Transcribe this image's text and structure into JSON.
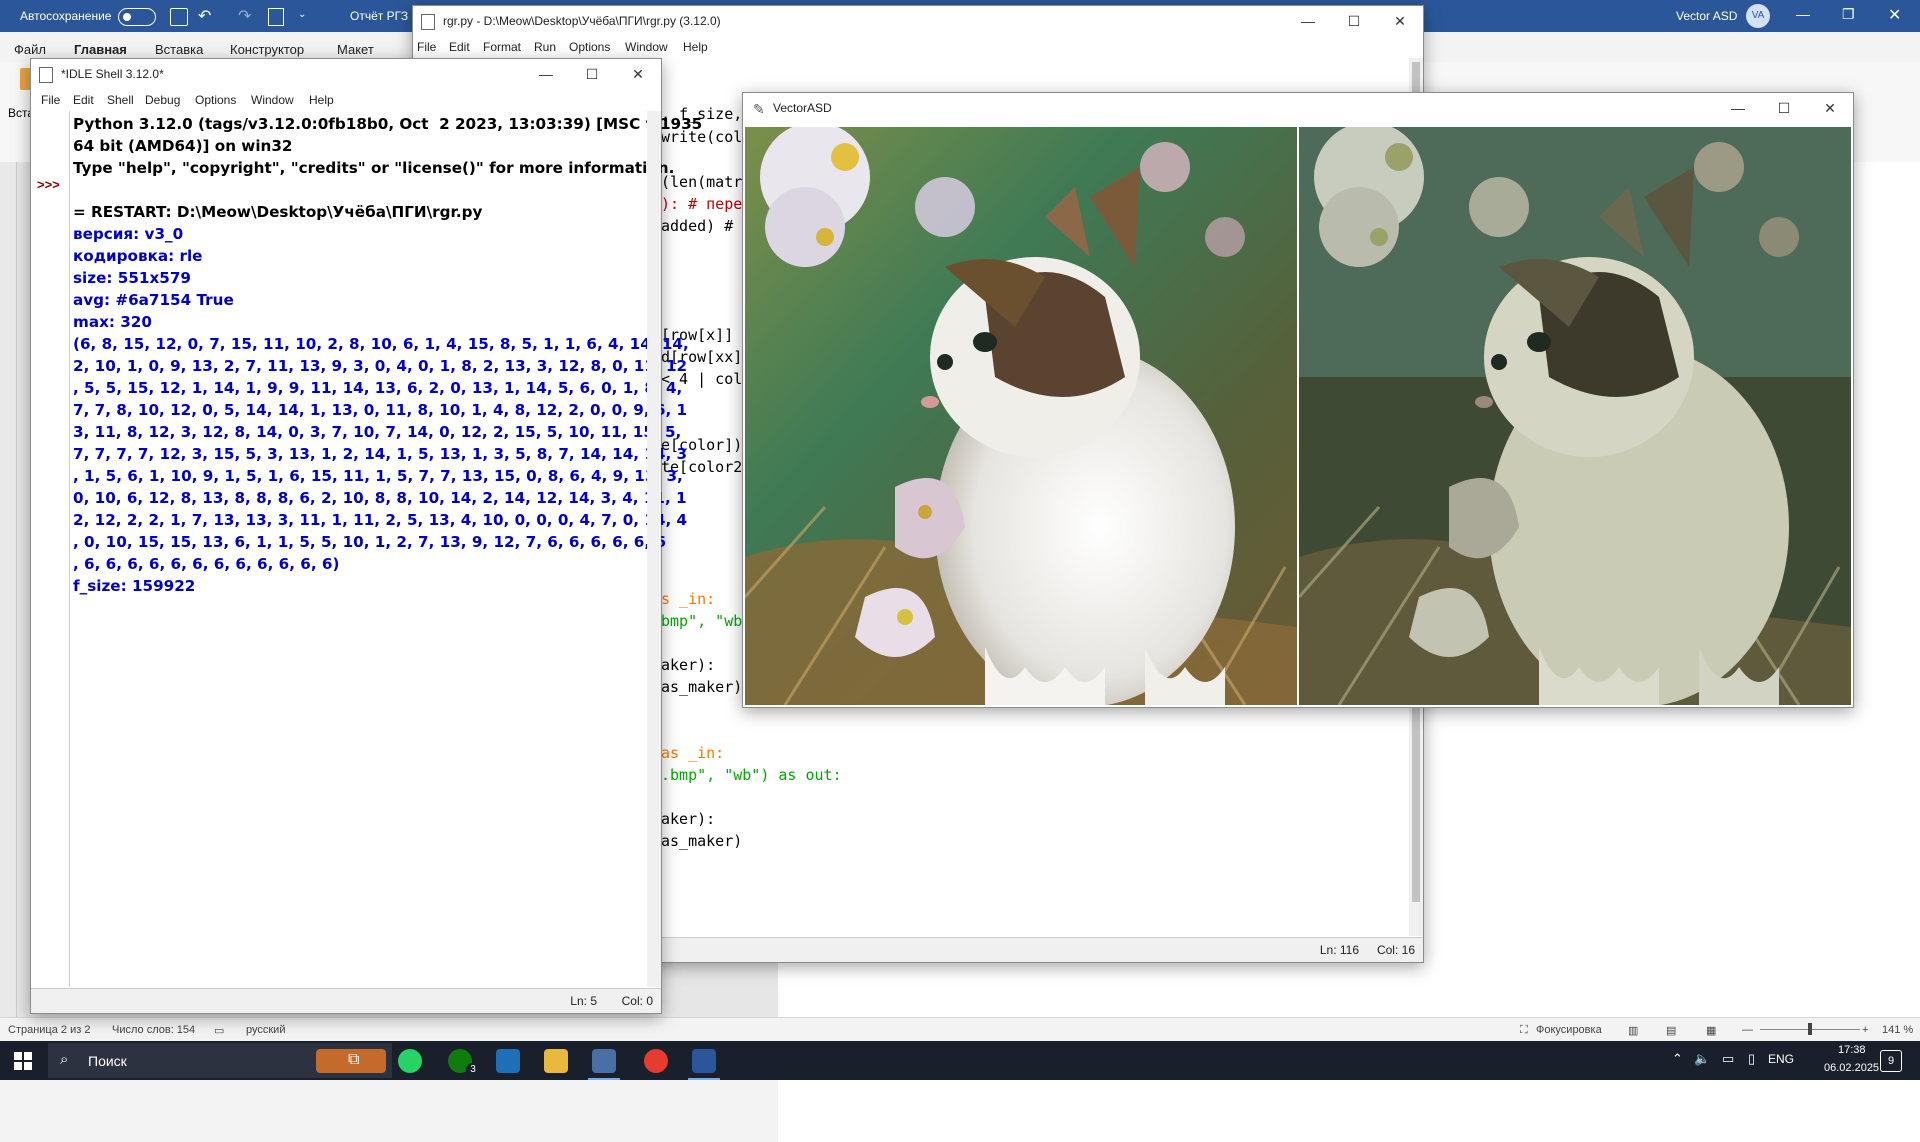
{
  "word": {
    "autosave_label": "Автосохранение",
    "doc_title": "Отчёт РГЗ",
    "user_name": "Vector ASD",
    "user_initials": "VA",
    "tabs": [
      "Файл",
      "Главная",
      "Вставка",
      "Конструктор",
      "Макет"
    ],
    "paste_label": "Вста",
    "status": {
      "page": "Страница 2 из 2",
      "words": "Число слов: 154",
      "language": "русский",
      "focus": "Фокусировка",
      "zoom": "141 %"
    }
  },
  "editor": {
    "title": "rgr.py - D:\\Meow\\Desktop\\Учёба\\ПГИ\\rgr.py (3.12.0)",
    "menu": [
      "File",
      "Edit",
      "Format",
      "Run",
      "Options",
      "Window",
      "Help"
    ],
    "code_fragments": [
      ", f_size, r",
      "write(color",
      "(len(matrix",
      "): # перевё",
      "added) # re",
      "[row[x]]",
      "d[row[xx]]",
      "< 4 | color",
      "e[color])",
      "te[color2])",
      "s _in:",
      "bmp\", \"wb\")",
      "aker):",
      "as_maker)",
      "as _in:",
      ".bmp\", \"wb\") as out:",
      "aker):",
      "as_maker)"
    ],
    "status": {
      "ln": "Ln: 116",
      "col": "Col: 16"
    }
  },
  "shell": {
    "title": "*IDLE Shell 3.12.0*",
    "menu": [
      "File",
      "Edit",
      "Shell",
      "Debug",
      "Options",
      "Window",
      "Help"
    ],
    "prompt": ">>>",
    "lines": [
      {
        "text": "Python 3.12.0 (tags/v3.12.0:0fb18b0, Oct  2 2023, 13:03:39) [MSC v.1935",
        "color": "blk"
      },
      {
        "text": "64 bit (AMD64)] on win32",
        "color": "blk"
      },
      {
        "text": "Type \"help\", \"copyright\", \"credits\" or \"license()\" for more information.",
        "color": "blk"
      },
      {
        "text": "",
        "color": "blk"
      },
      {
        "text": "= RESTART: D:\\Meow\\Desktop\\Учёба\\ПГИ\\rgr.py",
        "color": "blk"
      },
      {
        "text": "версия: v3_0",
        "color": "blue"
      },
      {
        "text": "кодировка: rle",
        "color": "blue"
      },
      {
        "text": "size: 551x579",
        "color": "blue"
      },
      {
        "text": "avg: #6a7154 True",
        "color": "blue"
      },
      {
        "text": "max: 320",
        "color": "blue"
      },
      {
        "text": "(6, 8, 15, 12, 0, 7, 15, 11, 10, 2, 8, 10, 6, 1, 4, 15, 8, 5, 1, 1, 6, 4, 14, 14,",
        "color": "blue"
      },
      {
        "text": "2, 10, 1, 0, 9, 13, 2, 7, 11, 13, 9, 3, 0, 4, 0, 1, 8, 2, 13, 3, 12, 8, 0, 11, 12",
        "color": "blue"
      },
      {
        "text": ", 5, 5, 15, 12, 1, 14, 1, 9, 9, 11, 14, 13, 6, 2, 0, 13, 1, 14, 5, 6, 0, 1, 8, 4,",
        "color": "blue"
      },
      {
        "text": "7, 7, 8, 10, 12, 0, 5, 14, 14, 1, 13, 0, 11, 8, 10, 1, 4, 8, 12, 2, 0, 0, 9, 6, 1",
        "color": "blue"
      },
      {
        "text": "3, 11, 8, 12, 3, 12, 8, 14, 0, 3, 7, 10, 7, 14, 0, 12, 2, 15, 5, 10, 11, 15, 5,",
        "color": "blue"
      },
      {
        "text": "7, 7, 7, 7, 12, 3, 15, 5, 3, 13, 1, 2, 14, 1, 5, 13, 1, 3, 5, 8, 7, 14, 14, 14, 3",
        "color": "blue"
      },
      {
        "text": ", 1, 5, 6, 1, 10, 9, 1, 5, 1, 6, 15, 11, 1, 5, 7, 7, 13, 15, 0, 8, 6, 4, 9, 13, 3,",
        "color": "blue"
      },
      {
        "text": "0, 10, 6, 12, 8, 13, 8, 8, 8, 6, 2, 10, 8, 8, 10, 14, 2, 14, 12, 14, 3, 4, 11, 1",
        "color": "blue"
      },
      {
        "text": "2, 12, 2, 2, 1, 7, 13, 13, 3, 11, 1, 11, 2, 5, 13, 4, 10, 0, 0, 0, 4, 7, 0, 14, 4",
        "color": "blue"
      },
      {
        "text": ", 0, 10, 15, 15, 13, 6, 1, 1, 5, 5, 10, 1, 2, 7, 13, 9, 12, 7, 6, 6, 6, 6, 6, 6",
        "color": "blue"
      },
      {
        "text": ", 6, 6, 6, 6, 6, 6, 6, 6, 6, 6, 6, 6)",
        "color": "blue"
      },
      {
        "text": "f_size: 159922",
        "color": "blue"
      }
    ],
    "status": {
      "ln": "Ln: 5",
      "col": "Col: 0"
    }
  },
  "viewer": {
    "title": "VectorASD"
  },
  "taskbar": {
    "search_label": "Поиск",
    "language": "ENG",
    "time": "17:38",
    "date": "06.02.2025",
    "notif_count": "9",
    "xbox_badge": "3"
  }
}
